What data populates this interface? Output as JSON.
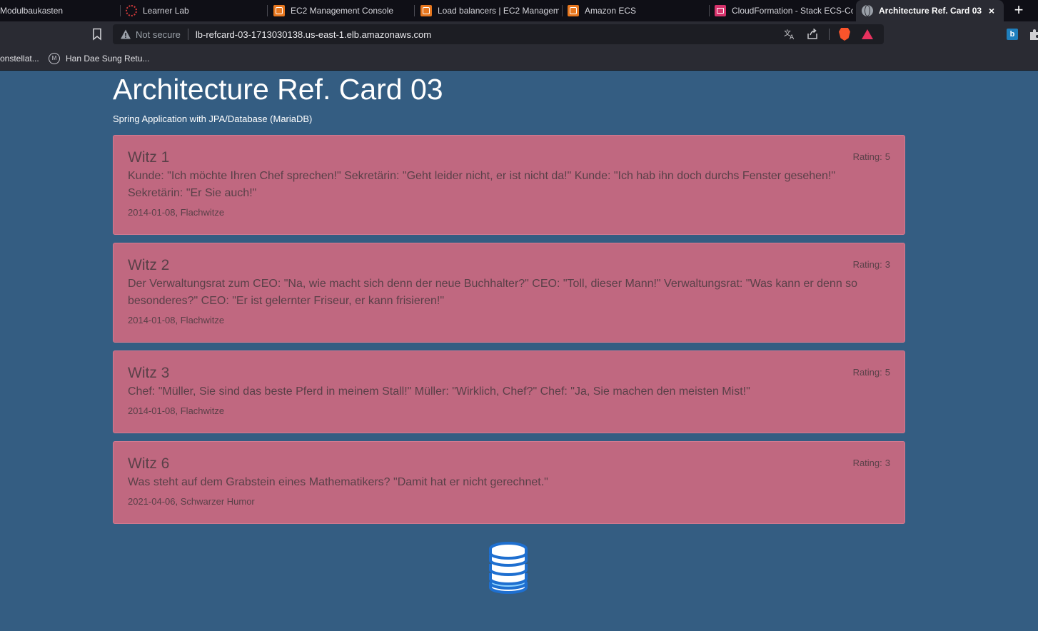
{
  "browser": {
    "tabs": [
      {
        "label": "Modulbaukasten",
        "icon": "page-icon",
        "active": false
      },
      {
        "label": "Learner Lab",
        "icon": "learner-lab-icon",
        "active": false
      },
      {
        "label": "EC2 Management Console",
        "icon": "aws-icon",
        "active": false
      },
      {
        "label": "Load balancers | EC2 Manageme",
        "icon": "aws-icon",
        "active": false
      },
      {
        "label": "Amazon ECS",
        "icon": "aws-icon",
        "active": false
      },
      {
        "label": "CloudFormation - Stack ECS-Co",
        "icon": "cloudformation-icon",
        "active": false
      },
      {
        "label": "Architecture Ref. Card 03",
        "icon": "globe-icon",
        "active": true
      }
    ],
    "close_tab_label": "×",
    "new_tab_label": "+",
    "address": {
      "security_label": "Not secure",
      "url": "lb-refcard-03-1713030138.us-east-1.elb.amazonaws.com"
    },
    "extension_label": "b",
    "bookmarks": [
      {
        "label": "onstellat..."
      },
      {
        "label": "Han Dae Sung Retu..."
      }
    ]
  },
  "page": {
    "title": "Architecture Ref. Card 03",
    "subtitle": "Spring Application with JPA/Database (MariaDB)",
    "rating_label": "Rating:",
    "jokes": [
      {
        "title": "Witz 1",
        "rating": "5",
        "text": "Kunde: \"Ich möchte Ihren Chef sprechen!\" Sekretärin: \"Geht leider nicht, er ist nicht da!\" Kunde: \"Ich hab ihn doch durchs Fenster gesehen!\" Sekretärin: \"Er Sie auch!\"",
        "date": "2014-01-08",
        "category": "Flachwitze"
      },
      {
        "title": "Witz 2",
        "rating": "3",
        "text": "Der Verwaltungsrat zum CEO: \"Na, wie macht sich denn der neue Buchhalter?\" CEO: \"Toll, dieser Mann!\" Verwaltungsrat: \"Was kann er denn so besonderes?\" CEO: \"Er ist gelernter Friseur, er kann frisieren!\"",
        "date": "2014-01-08",
        "category": "Flachwitze"
      },
      {
        "title": "Witz 3",
        "rating": "5",
        "text": "Chef: \"Müller, Sie sind das beste Pferd in meinem Stall!\" Müller: \"Wirklich, Chef?\" Chef: \"Ja, Sie machen den meisten Mist!\"",
        "date": "2014-01-08",
        "category": "Flachwitze"
      },
      {
        "title": "Witz 6",
        "rating": "3",
        "text": "Was steht auf dem Grabstein eines Mathematikers? \"Damit hat er nicht gerechnet.\"",
        "date": "2021-04-06",
        "category": "Schwarzer Humor"
      }
    ],
    "footer_icon": "database-icon"
  },
  "colors": {
    "page_background": "#345d82",
    "card_background": "#c06880",
    "card_text": "#5a4048",
    "tabbar": "#0f0f16",
    "toolbar": "#2a2b33",
    "database_icon": "#1e6fd0"
  }
}
